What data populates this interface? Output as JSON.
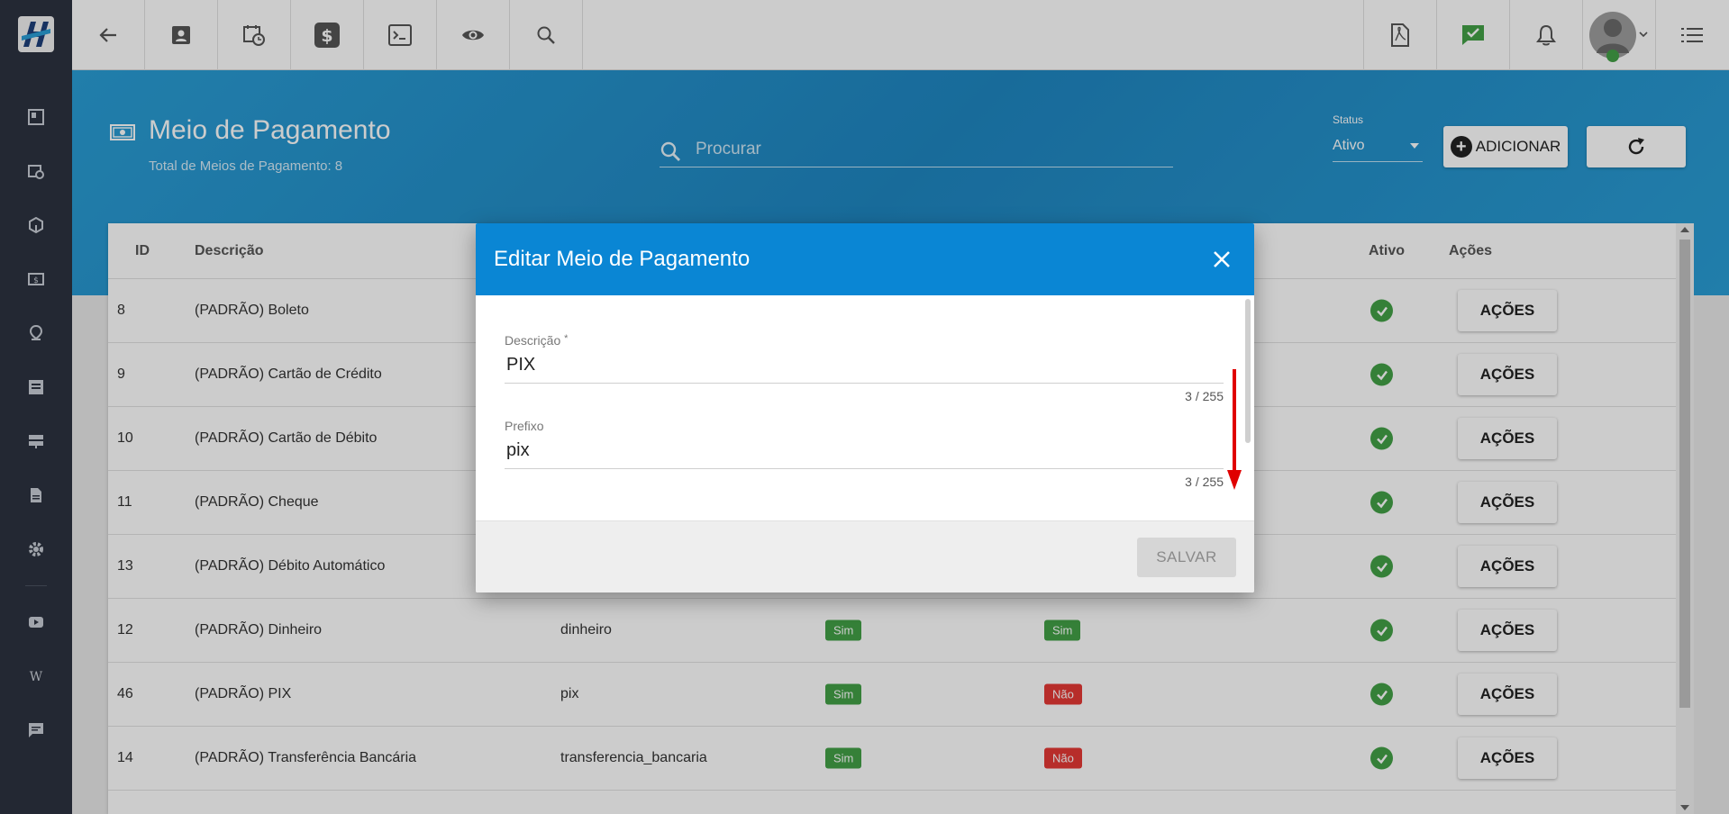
{
  "app": {
    "logo_letter": "H"
  },
  "sidebar": {
    "icons": [
      "dashboard-icon",
      "calendar-clock-icon",
      "cube-icon",
      "money-icon",
      "location-pin-icon",
      "list-icon",
      "server-icon",
      "document-icon",
      "gear-icon",
      "youtube-icon",
      "wikipedia-icon",
      "chat-icon"
    ]
  },
  "topbar": {
    "left_icons": [
      "back-arrow-icon",
      "contact-card-icon",
      "calendar-clock-icon",
      "dollar-icon",
      "terminal-icon",
      "eye-icon",
      "search-icon"
    ],
    "right_icons": [
      "pdf-icon",
      "chat-check-icon",
      "bell-icon",
      "avatar",
      "menu-icon"
    ]
  },
  "page": {
    "title": "Meio de Pagamento",
    "subtitle": "Total de Meios de Pagamento: 8",
    "search_placeholder": "Procurar",
    "status_label": "Status",
    "status_value": "Ativo",
    "add_label": "ADICIONAR"
  },
  "table": {
    "headers": {
      "id": "ID",
      "descricao": "Descrição",
      "ativo": "Ativo",
      "acoes": "Ações"
    },
    "action_label": "AÇÕES",
    "rows": [
      {
        "id": "8",
        "descricao": "(PADRÃO) Boleto",
        "prefixo": "",
        "b1": "",
        "b2": ""
      },
      {
        "id": "9",
        "descricao": "(PADRÃO) Cartão de Crédito",
        "prefixo": "",
        "b1": "",
        "b2": ""
      },
      {
        "id": "10",
        "descricao": "(PADRÃO) Cartão de Débito",
        "prefixo": "",
        "b1": "",
        "b2": ""
      },
      {
        "id": "11",
        "descricao": "(PADRÃO) Cheque",
        "prefixo": "",
        "b1": "",
        "b2": ""
      },
      {
        "id": "13",
        "descricao": "(PADRÃO) Débito Automático",
        "prefixo": "",
        "b1": "",
        "b2": ""
      },
      {
        "id": "12",
        "descricao": "(PADRÃO) Dinheiro",
        "prefixo": "dinheiro",
        "b1": "Sim",
        "b2": "Sim"
      },
      {
        "id": "46",
        "descricao": "(PADRÃO) PIX",
        "prefixo": "pix",
        "b1": "Sim",
        "b2": "Não"
      },
      {
        "id": "14",
        "descricao": "(PADRÃO) Transferência Bancária",
        "prefixo": "transferencia_bancaria",
        "b1": "Sim",
        "b2": "Não"
      }
    ]
  },
  "modal": {
    "title": "Editar Meio de Pagamento",
    "descricao_label": "Descrição",
    "descricao_required": "*",
    "descricao_value": "PIX",
    "descricao_counter": "3 / 255",
    "prefixo_label": "Prefixo",
    "prefixo_value": "pix",
    "prefixo_counter": "3 / 255",
    "save_label": "SALVAR"
  },
  "colors": {
    "primary": "#0a86d4",
    "banner": "#2a9ed6",
    "sidebar": "#2c3340",
    "success": "#43a047",
    "danger": "#e53935",
    "annotation_arrow": "#e00000"
  }
}
